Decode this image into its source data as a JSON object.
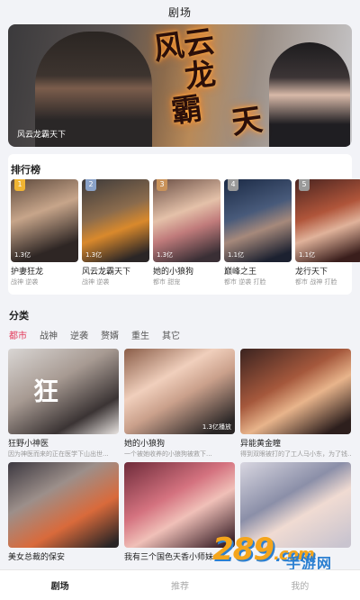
{
  "header": {
    "title": "剧场"
  },
  "banner": {
    "caption": "风云龙霸天下",
    "art_text": [
      "风云",
      "龙",
      "霸",
      "天"
    ]
  },
  "ranking": {
    "title": "排行榜",
    "items": [
      {
        "rank": "1",
        "plays": "1.3亿",
        "title": "护妻狂龙",
        "tags": "战神 逆袭",
        "badge_color": "#f0b433"
      },
      {
        "rank": "2",
        "plays": "1.3亿",
        "title": "风云龙霸天下",
        "tags": "战神 逆袭",
        "badge_color": "#8aa2c8"
      },
      {
        "rank": "3",
        "plays": "1.3亿",
        "title": "她的小狼狗",
        "tags": "都市 甜宠",
        "badge_color": "#c9925a"
      },
      {
        "rank": "4",
        "plays": "1.1亿",
        "title": "巅峰之王",
        "tags": "都市 逆袭 打脸",
        "badge_color": "#9a9a9a"
      },
      {
        "rank": "5",
        "plays": "1.1亿",
        "title": "龙行天下",
        "tags": "都市 战神 打脸",
        "badge_color": "#9a9a9a"
      }
    ]
  },
  "category": {
    "title": "分类",
    "tabs": [
      "都市",
      "战神",
      "逆袭",
      "赘婿",
      "重生",
      "其它"
    ],
    "active_tab": "都市",
    "items": [
      {
        "title": "狂野小神医",
        "desc": "因为神医而来的正在医学下山出世...",
        "plays": "",
        "overlay": "狂"
      },
      {
        "title": "她的小狼狗",
        "desc": "一个被她收养的小狼狗被救下...",
        "plays": "1.3亿播放",
        "overlay": ""
      },
      {
        "title": "异能黄金瞳",
        "desc": "得到双眼被打的了工人马小东，为了钱...",
        "plays": "",
        "overlay": ""
      },
      {
        "title": "美女总裁的保安",
        "desc": "",
        "plays": "",
        "overlay": ""
      },
      {
        "title": "我有三个国色天香小师妹",
        "desc": "",
        "plays": "",
        "overlay": ""
      },
      {
        "title": "",
        "desc": "",
        "plays": "",
        "overlay": ""
      }
    ]
  },
  "watermark": {
    "number": "289",
    "suffix": ".com",
    "text": "手游网"
  },
  "bottom_nav": {
    "items": [
      "剧场",
      "推荐",
      "我的"
    ],
    "active": "剧场"
  },
  "colors": {
    "accent": "#e2395a",
    "background": "#f2f3f7"
  }
}
